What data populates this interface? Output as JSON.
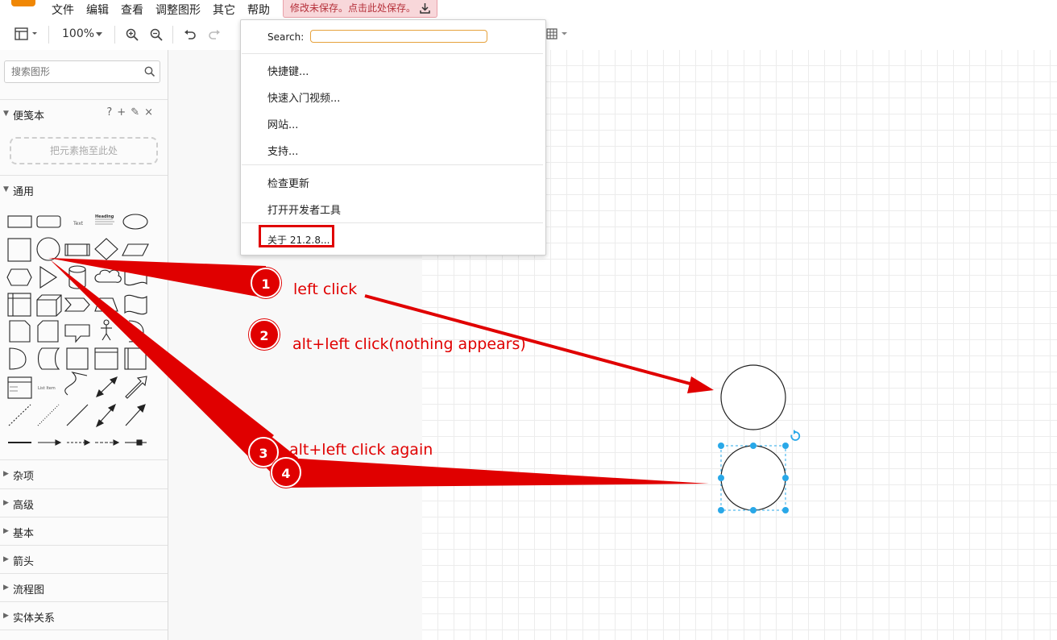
{
  "menubar": {
    "items": [
      "文件",
      "编辑",
      "查看",
      "调整图形",
      "其它",
      "帮助"
    ],
    "unsaved_notice": "修改未保存。点击此处保存。"
  },
  "toolbar": {
    "zoom": "100%"
  },
  "help_menu": {
    "search_label": "Search:",
    "search_value": "",
    "items": [
      "快捷键...",
      "快速入门视频...",
      "网站...",
      "支持...",
      "检查更新",
      "打开开发者工具",
      "关于 21.2.8..."
    ]
  },
  "sidebar": {
    "search_placeholder": "搜索图形",
    "scratchpad": {
      "title": "便笺本",
      "dropzone": "把元素拖至此处",
      "tools": [
        "?",
        "+",
        "✎",
        "×"
      ]
    },
    "general": {
      "title": "通用",
      "shape_labels": [
        "Text",
        "Heading",
        "List Item"
      ]
    },
    "sections": [
      "杂项",
      "高级",
      "基本",
      "箭头",
      "流程图",
      "实体关系"
    ]
  },
  "annotations": {
    "steps": [
      {
        "num": "1",
        "text": "left click"
      },
      {
        "num": "2",
        "text": "alt+left click(nothing appears)"
      },
      {
        "num": "3",
        "text": "alt+left click again"
      },
      {
        "num": "4",
        "text": ""
      }
    ],
    "color": "#e00000"
  },
  "colors": {
    "logo": "#f08705",
    "selection": "#29a8e8",
    "unsaved_bg": "#f8d7da"
  }
}
